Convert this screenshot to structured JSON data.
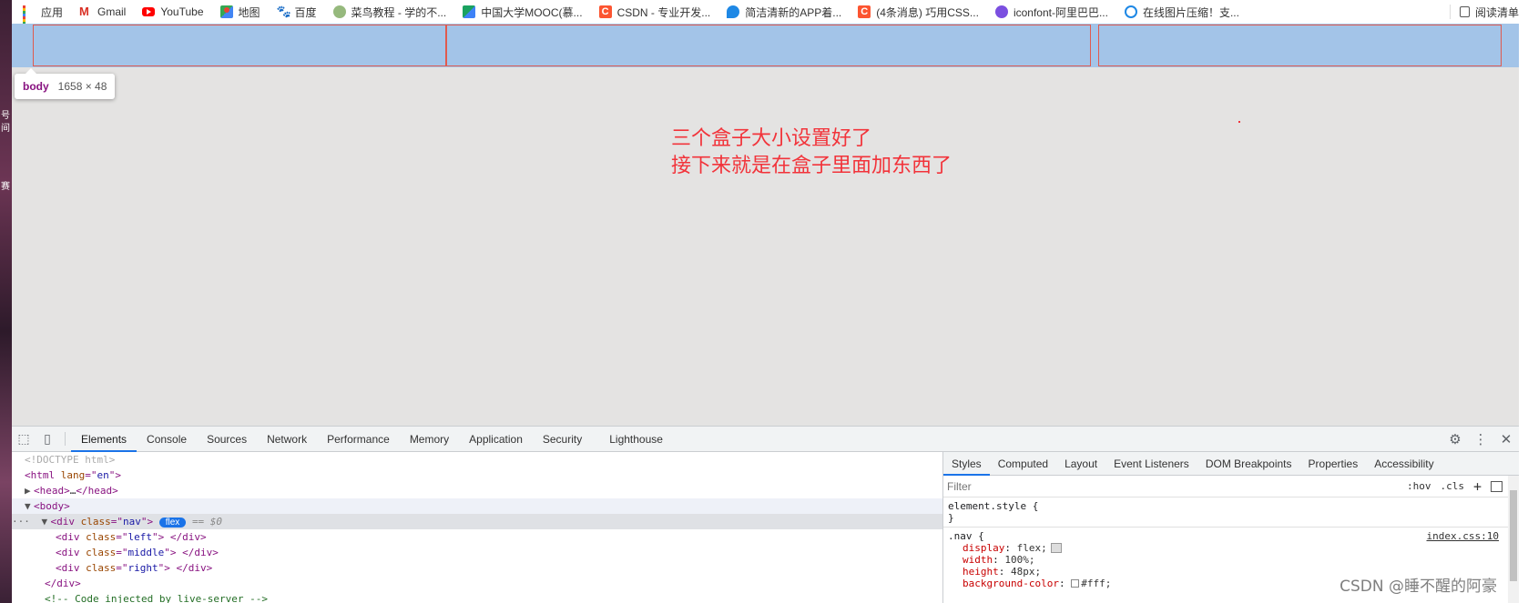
{
  "bookmarks": [
    {
      "label": "应用",
      "icon": "apps-grid-icon"
    },
    {
      "label": "Gmail",
      "icon": "gmail-icon"
    },
    {
      "label": "YouTube",
      "icon": "youtube-icon"
    },
    {
      "label": "地图",
      "icon": "maps-icon"
    },
    {
      "label": "百度",
      "icon": "baidu-icon"
    },
    {
      "label": "菜鸟教程 - 学的不...",
      "icon": "runoob-icon"
    },
    {
      "label": "中国大学MOOC(慕...",
      "icon": "mooc-icon"
    },
    {
      "label": "CSDN - 专业开发...",
      "icon": "csdn-icon"
    },
    {
      "label": "简洁清新的APP着...",
      "icon": "app-icon"
    },
    {
      "label": "(4条消息) 巧用CSS...",
      "icon": "csdn-icon"
    },
    {
      "label": "iconfont-阿里巴巴...",
      "icon": "iconfont-icon"
    },
    {
      "label": "在线图片压缩！支...",
      "icon": "compress-icon"
    }
  ],
  "reading_list": "阅读清单",
  "tooltip": {
    "tag": "body",
    "size": "1658 × 48"
  },
  "note": {
    "line1": "三个盒子大小设置好了",
    "line2": "接下来就是在盒子里面加东西了"
  },
  "devtools": {
    "tabs": [
      "Elements",
      "Console",
      "Sources",
      "Network",
      "Performance",
      "Memory",
      "Application",
      "Security",
      "Lighthouse"
    ],
    "active_tab": "Elements",
    "elements": {
      "doctype": "<!DOCTYPE html>",
      "html_tag": "html",
      "lang_attr": "lang",
      "lang_val": "en",
      "head": "head",
      "body": "body",
      "nav_div": "div",
      "class_attr": "class",
      "nav_class": "nav",
      "flex_badge": "flex",
      "eq_marker": "== $0",
      "children": [
        {
          "tag": "div",
          "class": "left"
        },
        {
          "tag": "div",
          "class": "middle"
        },
        {
          "tag": "div",
          "class": "right"
        }
      ],
      "close_div": "</div>",
      "comment": "<!-- Code injected by live-server -->"
    },
    "styles_tabs": [
      "Styles",
      "Computed",
      "Layout",
      "Event Listeners",
      "DOM Breakpoints",
      "Properties",
      "Accessibility"
    ],
    "active_styles_tab": "Styles",
    "filter_placeholder": "Filter",
    "hov": ":hov",
    "cls": ".cls",
    "element_style": "element.style {",
    "close_brace": "}",
    "rule": {
      "selector": ".nav {",
      "source": "index.css:10",
      "props": [
        {
          "name": "display",
          "value": "flex;"
        },
        {
          "name": "width",
          "value": "100%;"
        },
        {
          "name": "height",
          "value": "48px;"
        },
        {
          "name": "background-color",
          "value": "#fff;"
        }
      ]
    }
  },
  "watermark": "CSDN @睡不醒的阿豪",
  "colors": {
    "nav_bg": "#a3c4e8",
    "box_border": "#e05a4e",
    "note": "#f2333a",
    "accent": "#1a73e8"
  }
}
